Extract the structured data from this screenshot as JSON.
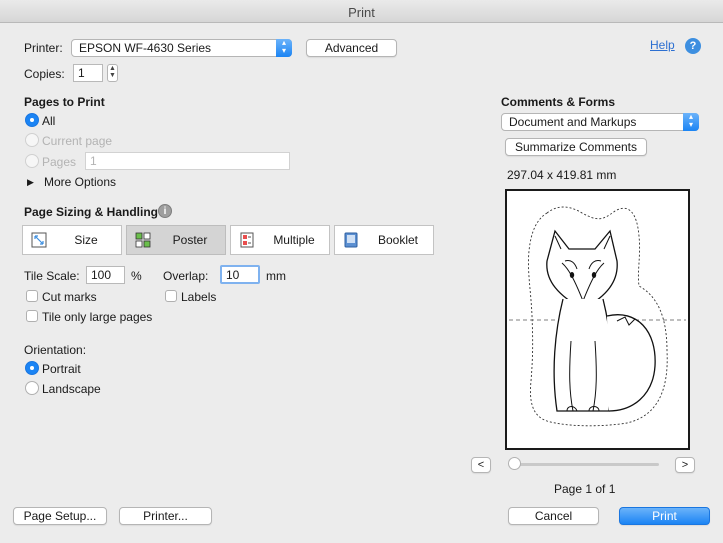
{
  "window": {
    "title": "Print"
  },
  "printer": {
    "label": "Printer:",
    "value": "EPSON WF-4630 Series",
    "advanced_label": "Advanced"
  },
  "help": {
    "label": "Help",
    "icon": "question-mark-icon"
  },
  "copies": {
    "label": "Copies:",
    "value": "1"
  },
  "pages_to_print": {
    "heading": "Pages to Print",
    "options": [
      {
        "label": "All",
        "selected": true,
        "enabled": true
      },
      {
        "label": "Current page",
        "selected": false,
        "enabled": false
      },
      {
        "label": "Pages",
        "selected": false,
        "enabled": false
      }
    ],
    "pages_field_value": "1",
    "more_options_label": "More Options"
  },
  "page_sizing": {
    "heading": "Page Sizing & Handling",
    "info_icon": "info-icon",
    "modes": [
      {
        "label": "Size",
        "selected": false,
        "icon": "size-icon"
      },
      {
        "label": "Poster",
        "selected": true,
        "icon": "poster-icon"
      },
      {
        "label": "Multiple",
        "selected": false,
        "icon": "multiple-icon"
      },
      {
        "label": "Booklet",
        "selected": false,
        "icon": "booklet-icon"
      }
    ],
    "tile_scale_label": "Tile Scale:",
    "tile_scale_value": "100",
    "tile_scale_unit": "%",
    "overlap_label": "Overlap:",
    "overlap_value": "10",
    "overlap_unit": "mm",
    "cut_marks_label": "Cut marks",
    "labels_label": "Labels",
    "tile_only_large_label": "Tile only large pages"
  },
  "orientation": {
    "heading": "Orientation:",
    "options": [
      {
        "label": "Portrait",
        "selected": true
      },
      {
        "label": "Landscape",
        "selected": false
      }
    ]
  },
  "comments_forms": {
    "heading": "Comments & Forms",
    "value": "Document and Markups",
    "summarize_label": "Summarize Comments"
  },
  "preview": {
    "page_size": "297.04 x 419.81 mm",
    "prev_label": "<",
    "next_label": ">",
    "page_indicator": "Page 1 of 1"
  },
  "footer": {
    "page_setup_label": "Page Setup...",
    "printer_label": "Printer...",
    "cancel_label": "Cancel",
    "print_label": "Print"
  },
  "colors": {
    "accent": "#1b84f4",
    "window_bg": "#ececec"
  }
}
